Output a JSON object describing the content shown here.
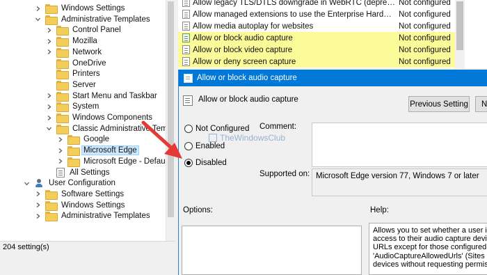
{
  "tree": {
    "items": [
      {
        "label": "Windows Settings",
        "indent": 1,
        "chevron": "right",
        "icon": "folder",
        "selected": false
      },
      {
        "label": "Administrative Templates",
        "indent": 1,
        "chevron": "down",
        "icon": "folder",
        "selected": false
      },
      {
        "label": "Control Panel",
        "indent": 2,
        "chevron": "right",
        "icon": "folder",
        "selected": false
      },
      {
        "label": "Mozilla",
        "indent": 2,
        "chevron": "right",
        "icon": "folder",
        "selected": false
      },
      {
        "label": "Network",
        "indent": 2,
        "chevron": "right",
        "icon": "folder",
        "selected": false
      },
      {
        "label": "OneDrive",
        "indent": 2,
        "chevron": "none",
        "icon": "folder",
        "selected": false
      },
      {
        "label": "Printers",
        "indent": 2,
        "chevron": "none",
        "icon": "folder",
        "selected": false
      },
      {
        "label": "Server",
        "indent": 2,
        "chevron": "none",
        "icon": "folder",
        "selected": false
      },
      {
        "label": "Start Menu and Taskbar",
        "indent": 2,
        "chevron": "right",
        "icon": "folder",
        "selected": false
      },
      {
        "label": "System",
        "indent": 2,
        "chevron": "right",
        "icon": "folder",
        "selected": false
      },
      {
        "label": "Windows Components",
        "indent": 2,
        "chevron": "right",
        "icon": "folder",
        "selected": false
      },
      {
        "label": "Classic Administrative Templates",
        "indent": 2,
        "chevron": "down",
        "icon": "folder",
        "selected": false
      },
      {
        "label": "Google",
        "indent": 3,
        "chevron": "right",
        "icon": "folder",
        "selected": false
      },
      {
        "label": "Microsoft Edge",
        "indent": 3,
        "chevron": "right",
        "icon": "folder",
        "selected": true
      },
      {
        "label": "Microsoft Edge - Default Settings",
        "indent": 3,
        "chevron": "right",
        "icon": "folder",
        "selected": false
      },
      {
        "label": "All Settings",
        "indent": 2,
        "chevron": "none",
        "icon": "doc",
        "selected": false
      },
      {
        "label": "User Configuration",
        "indent": 0,
        "chevron": "down",
        "icon": "user",
        "selected": false
      },
      {
        "label": "Software Settings",
        "indent": 1,
        "chevron": "right",
        "icon": "folder",
        "selected": false
      },
      {
        "label": "Windows Settings",
        "indent": 1,
        "chevron": "right",
        "icon": "folder",
        "selected": false
      },
      {
        "label": "Administrative Templates",
        "indent": 1,
        "chevron": "right",
        "icon": "folder",
        "selected": false
      }
    ]
  },
  "status": {
    "text": "204 setting(s)"
  },
  "policies": [
    {
      "name": "Allow legacy TLS/DTLS downgrade in WebRTC (deprecated)",
      "state": "Not configured",
      "highlight": false,
      "icon": "doc"
    },
    {
      "name": "Allow managed extensions to use the Enterprise Hardware P...",
      "state": "Not configured",
      "highlight": false,
      "icon": "doc"
    },
    {
      "name": "Allow media autoplay for websites",
      "state": "Not configured",
      "highlight": false,
      "icon": "doc"
    },
    {
      "name": "Allow or block audio capture",
      "state": "Not configured",
      "highlight": true,
      "icon": "green"
    },
    {
      "name": "Allow or block video capture",
      "state": "Not configured",
      "highlight": true,
      "icon": "doc"
    },
    {
      "name": "Allow or deny screen capture",
      "state": "Not configured",
      "highlight": true,
      "icon": "doc"
    }
  ],
  "dialog": {
    "title": "Allow or block audio capture",
    "header_title": "Allow or block audio capture",
    "prev_button": "Previous Setting",
    "next_button": "N",
    "radio_not_configured": "Not Configured",
    "radio_enabled": "Enabled",
    "radio_disabled": "Disabled",
    "selected_radio": "Disabled",
    "comment_label": "Comment:",
    "supported_label": "Supported on:",
    "supported_value": "Microsoft Edge version 77, Windows 7 or later",
    "options_label": "Options:",
    "help_label": "Help:",
    "help_lines": [
      "Allows you to set whether a user is p",
      "access to their audio capture device.",
      "URLs except for those configured in",
      "'AudioCaptureAllowedUrls' (Sites tha",
      "devices without requesting permissi"
    ]
  },
  "watermark": {
    "text": "TheWindowsClub"
  },
  "colors": {
    "titlebar": "#0078d7",
    "highlight_row": "#fbfb9a",
    "selected_tree": "#cce8ff",
    "annotation_arrow": "#e53935"
  }
}
